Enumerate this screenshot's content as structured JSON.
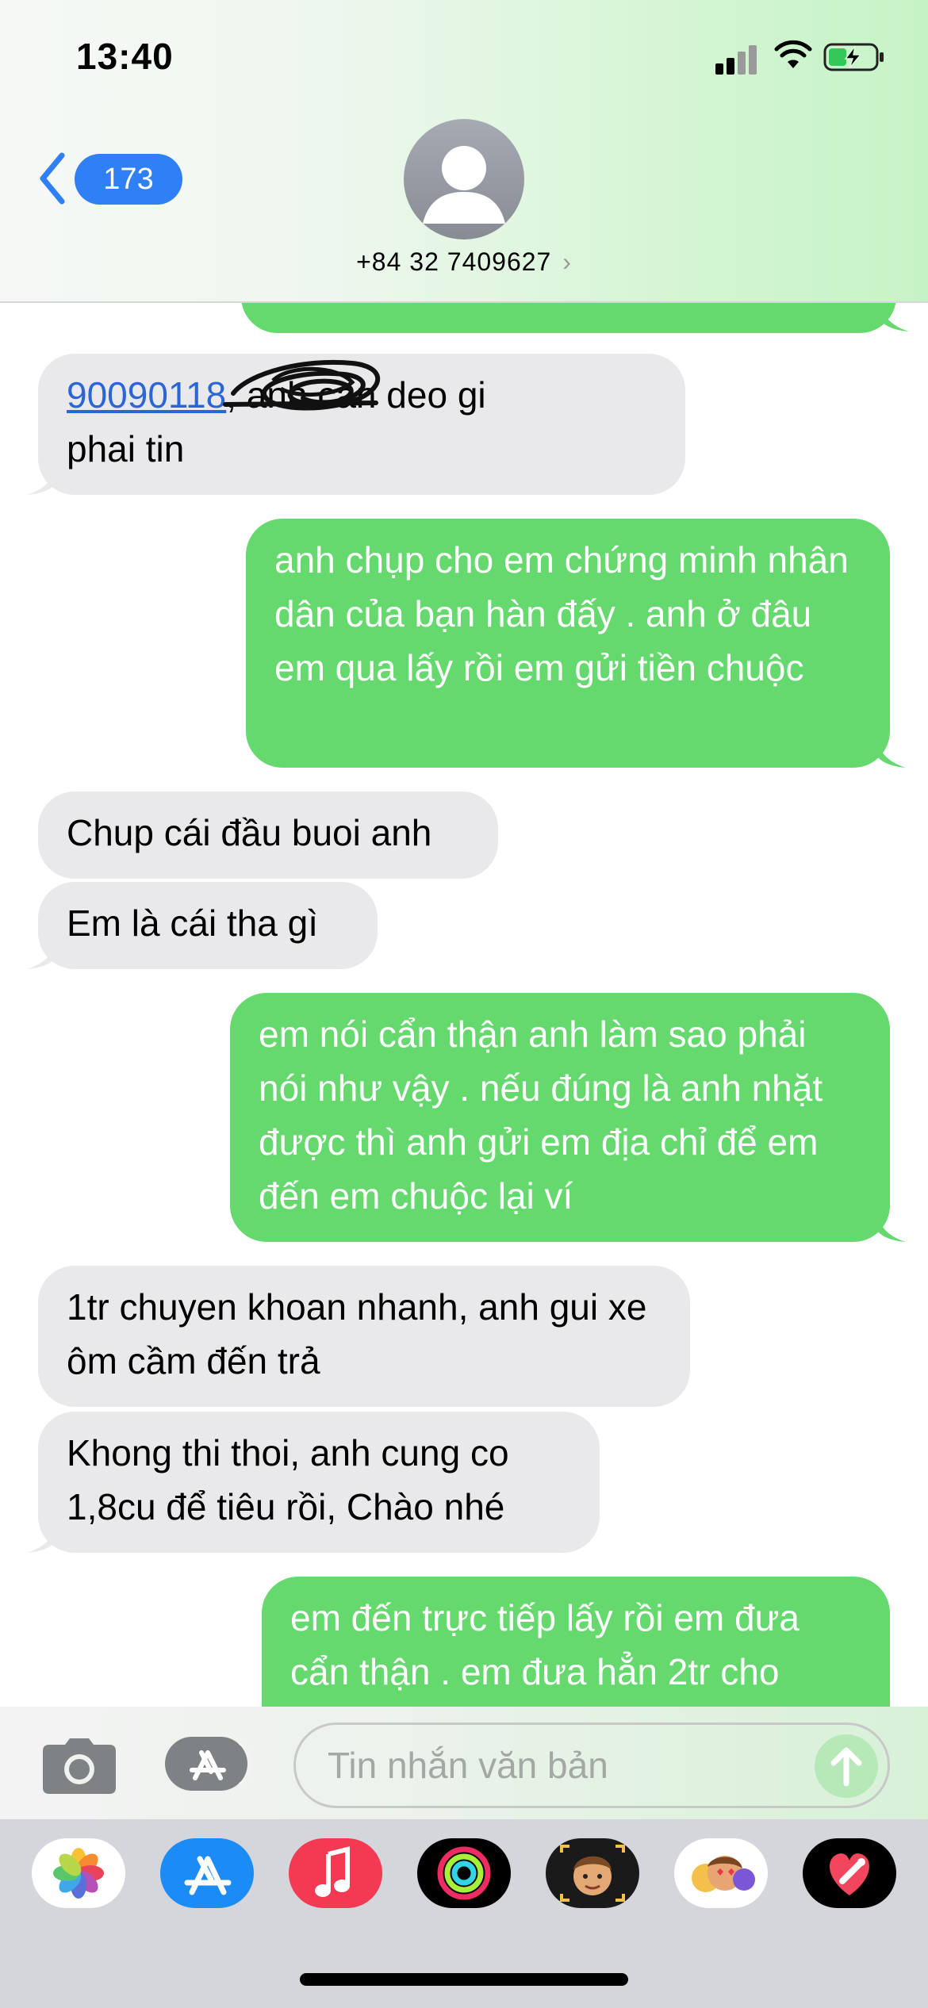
{
  "status_bar": {
    "time": "13:40"
  },
  "header": {
    "back_badge": "173",
    "contact_number": "+84 32 7409627",
    "contact_chevron": "›"
  },
  "messages": [
    {
      "side": "in",
      "link": "90090118",
      "text": ", anh can deo gi\nphai tin"
    },
    {
      "side": "out",
      "text": "anh chụp cho em chứng minh nhân dân của bạn hàn đấy . anh ở đâu em qua lấy rồi em gửi tiền chuộc"
    },
    {
      "side": "in",
      "text": "Chup cái đầu buoi anh"
    },
    {
      "side": "in",
      "text": "Em là cái tha gì"
    },
    {
      "side": "out",
      "text": "em nói cẩn thận anh làm sao phải nói như vậy . nếu đúng là anh nhặt được thì anh gửi em địa chỉ để em đến em chuộc lại ví"
    },
    {
      "side": "in",
      "text": "1tr chuyen khoan nhanh, anh gui xe ôm cầm đến trả"
    },
    {
      "side": "in",
      "text": "Khong thi thoi, anh cung co 1,8cu để tiêu rồi, Chào nhé"
    },
    {
      "side": "out",
      "text": "em đến trực tiếp lấy rồi em đưa cẩn thận . em đưa hẳn 2tr cho"
    }
  ],
  "input": {
    "placeholder": "Tin nhắn văn bản"
  },
  "app_drawer": [
    {
      "icon": "photos-icon"
    },
    {
      "icon": "app-store-icon"
    },
    {
      "icon": "music-icon"
    },
    {
      "icon": "activity-icon"
    },
    {
      "icon": "memoji-icon"
    },
    {
      "icon": "animoji-stickers-icon"
    },
    {
      "icon": "digital-touch-icon"
    }
  ],
  "colors": {
    "outgoing_bubble": "#65d86e",
    "incoming_bubble": "#e9e9eb",
    "accent_blue": "#2f7ff6"
  }
}
